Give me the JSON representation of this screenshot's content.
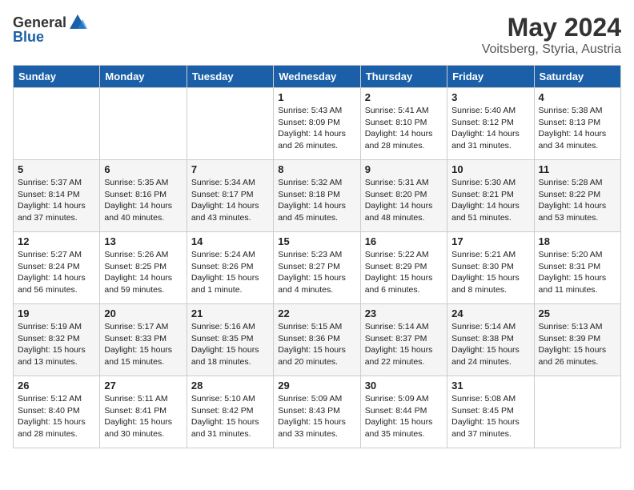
{
  "header": {
    "logo_general": "General",
    "logo_blue": "Blue",
    "title": "May 2024",
    "location": "Voitsberg, Styria, Austria"
  },
  "weekdays": [
    "Sunday",
    "Monday",
    "Tuesday",
    "Wednesday",
    "Thursday",
    "Friday",
    "Saturday"
  ],
  "weeks": [
    [
      {
        "day": "",
        "info": ""
      },
      {
        "day": "",
        "info": ""
      },
      {
        "day": "",
        "info": ""
      },
      {
        "day": "1",
        "info": "Sunrise: 5:43 AM\nSunset: 8:09 PM\nDaylight: 14 hours\nand 26 minutes."
      },
      {
        "day": "2",
        "info": "Sunrise: 5:41 AM\nSunset: 8:10 PM\nDaylight: 14 hours\nand 28 minutes."
      },
      {
        "day": "3",
        "info": "Sunrise: 5:40 AM\nSunset: 8:12 PM\nDaylight: 14 hours\nand 31 minutes."
      },
      {
        "day": "4",
        "info": "Sunrise: 5:38 AM\nSunset: 8:13 PM\nDaylight: 14 hours\nand 34 minutes."
      }
    ],
    [
      {
        "day": "5",
        "info": "Sunrise: 5:37 AM\nSunset: 8:14 PM\nDaylight: 14 hours\nand 37 minutes."
      },
      {
        "day": "6",
        "info": "Sunrise: 5:35 AM\nSunset: 8:16 PM\nDaylight: 14 hours\nand 40 minutes."
      },
      {
        "day": "7",
        "info": "Sunrise: 5:34 AM\nSunset: 8:17 PM\nDaylight: 14 hours\nand 43 minutes."
      },
      {
        "day": "8",
        "info": "Sunrise: 5:32 AM\nSunset: 8:18 PM\nDaylight: 14 hours\nand 45 minutes."
      },
      {
        "day": "9",
        "info": "Sunrise: 5:31 AM\nSunset: 8:20 PM\nDaylight: 14 hours\nand 48 minutes."
      },
      {
        "day": "10",
        "info": "Sunrise: 5:30 AM\nSunset: 8:21 PM\nDaylight: 14 hours\nand 51 minutes."
      },
      {
        "day": "11",
        "info": "Sunrise: 5:28 AM\nSunset: 8:22 PM\nDaylight: 14 hours\nand 53 minutes."
      }
    ],
    [
      {
        "day": "12",
        "info": "Sunrise: 5:27 AM\nSunset: 8:24 PM\nDaylight: 14 hours\nand 56 minutes."
      },
      {
        "day": "13",
        "info": "Sunrise: 5:26 AM\nSunset: 8:25 PM\nDaylight: 14 hours\nand 59 minutes."
      },
      {
        "day": "14",
        "info": "Sunrise: 5:24 AM\nSunset: 8:26 PM\nDaylight: 15 hours\nand 1 minute."
      },
      {
        "day": "15",
        "info": "Sunrise: 5:23 AM\nSunset: 8:27 PM\nDaylight: 15 hours\nand 4 minutes."
      },
      {
        "day": "16",
        "info": "Sunrise: 5:22 AM\nSunset: 8:29 PM\nDaylight: 15 hours\nand 6 minutes."
      },
      {
        "day": "17",
        "info": "Sunrise: 5:21 AM\nSunset: 8:30 PM\nDaylight: 15 hours\nand 8 minutes."
      },
      {
        "day": "18",
        "info": "Sunrise: 5:20 AM\nSunset: 8:31 PM\nDaylight: 15 hours\nand 11 minutes."
      }
    ],
    [
      {
        "day": "19",
        "info": "Sunrise: 5:19 AM\nSunset: 8:32 PM\nDaylight: 15 hours\nand 13 minutes."
      },
      {
        "day": "20",
        "info": "Sunrise: 5:17 AM\nSunset: 8:33 PM\nDaylight: 15 hours\nand 15 minutes."
      },
      {
        "day": "21",
        "info": "Sunrise: 5:16 AM\nSunset: 8:35 PM\nDaylight: 15 hours\nand 18 minutes."
      },
      {
        "day": "22",
        "info": "Sunrise: 5:15 AM\nSunset: 8:36 PM\nDaylight: 15 hours\nand 20 minutes."
      },
      {
        "day": "23",
        "info": "Sunrise: 5:14 AM\nSunset: 8:37 PM\nDaylight: 15 hours\nand 22 minutes."
      },
      {
        "day": "24",
        "info": "Sunrise: 5:14 AM\nSunset: 8:38 PM\nDaylight: 15 hours\nand 24 minutes."
      },
      {
        "day": "25",
        "info": "Sunrise: 5:13 AM\nSunset: 8:39 PM\nDaylight: 15 hours\nand 26 minutes."
      }
    ],
    [
      {
        "day": "26",
        "info": "Sunrise: 5:12 AM\nSunset: 8:40 PM\nDaylight: 15 hours\nand 28 minutes."
      },
      {
        "day": "27",
        "info": "Sunrise: 5:11 AM\nSunset: 8:41 PM\nDaylight: 15 hours\nand 30 minutes."
      },
      {
        "day": "28",
        "info": "Sunrise: 5:10 AM\nSunset: 8:42 PM\nDaylight: 15 hours\nand 31 minutes."
      },
      {
        "day": "29",
        "info": "Sunrise: 5:09 AM\nSunset: 8:43 PM\nDaylight: 15 hours\nand 33 minutes."
      },
      {
        "day": "30",
        "info": "Sunrise: 5:09 AM\nSunset: 8:44 PM\nDaylight: 15 hours\nand 35 minutes."
      },
      {
        "day": "31",
        "info": "Sunrise: 5:08 AM\nSunset: 8:45 PM\nDaylight: 15 hours\nand 37 minutes."
      },
      {
        "day": "",
        "info": ""
      }
    ]
  ]
}
